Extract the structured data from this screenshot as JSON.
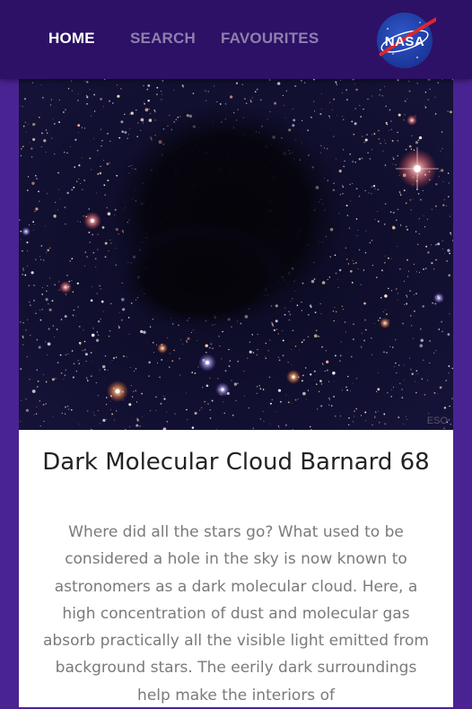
{
  "nav": {
    "home_label": "HOME",
    "search_label": "SEARCH",
    "favourites_label": "FAVOURITES",
    "logo_text": "NASA"
  },
  "image": {
    "credit": "ESO"
  },
  "article": {
    "title": "Dark Molecular Cloud Barnard 68",
    "description": "Where did all the stars go? What used to be considered a hole in the sky is now known to astronomers as a dark molecular cloud. Here, a high concentration of dust and molecular gas absorb practically all the visible light emitted from background stars. The eerily dark surroundings help make the interiors of"
  },
  "colors": {
    "background": "#4a2393",
    "topbar": "#2d1166",
    "nav_active": "#ffffff",
    "nav_inactive": "#8e80ad",
    "nasa_blue": "#1e3fa8",
    "nasa_red": "#e0262a"
  }
}
